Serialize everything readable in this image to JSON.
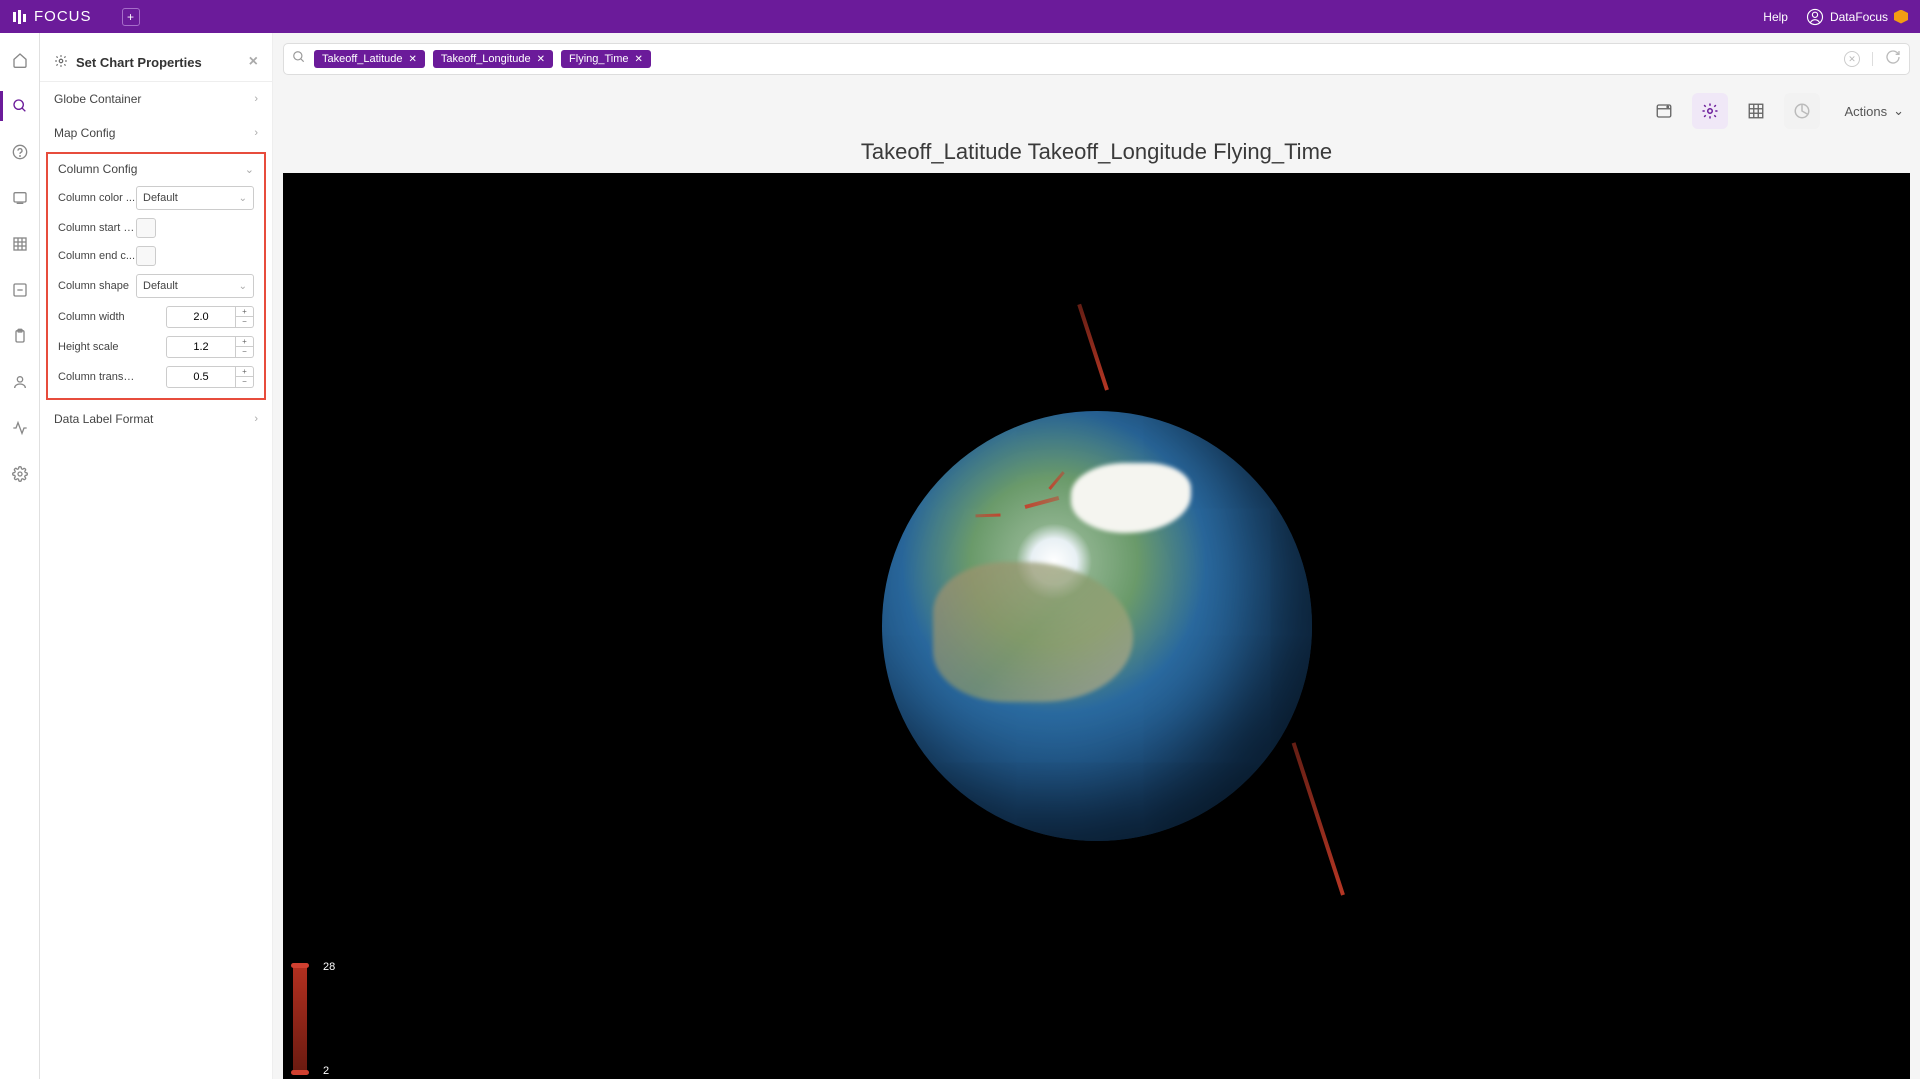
{
  "header": {
    "brand": "FOCUS",
    "help": "Help",
    "user": "DataFocus"
  },
  "panel": {
    "title": "Set Chart Properties",
    "sections": {
      "globe_container": "Globe Container",
      "map_config": "Map Config",
      "column_config": "Column Config",
      "data_label_format": "Data Label Format"
    },
    "fields": {
      "column_color_label": "Column color ...",
      "column_color_value": "Default",
      "column_start_label": "Column start c...",
      "column_end_label": "Column end c...",
      "column_shape_label": "Column shape",
      "column_shape_value": "Default",
      "column_width_label": "Column width",
      "column_width_value": "2.0",
      "height_scale_label": "Height scale",
      "height_scale_value": "1.2",
      "column_transp_label": "Column transp...",
      "column_transp_value": "0.5"
    }
  },
  "search": {
    "pills": [
      "Takeoff_Latitude",
      "Takeoff_Longitude",
      "Flying_Time"
    ]
  },
  "toolbar": {
    "actions": "Actions"
  },
  "chart": {
    "title": "Takeoff_Latitude Takeoff_Longitude Flying_Time",
    "legend_max": "28",
    "legend_min": "2"
  }
}
